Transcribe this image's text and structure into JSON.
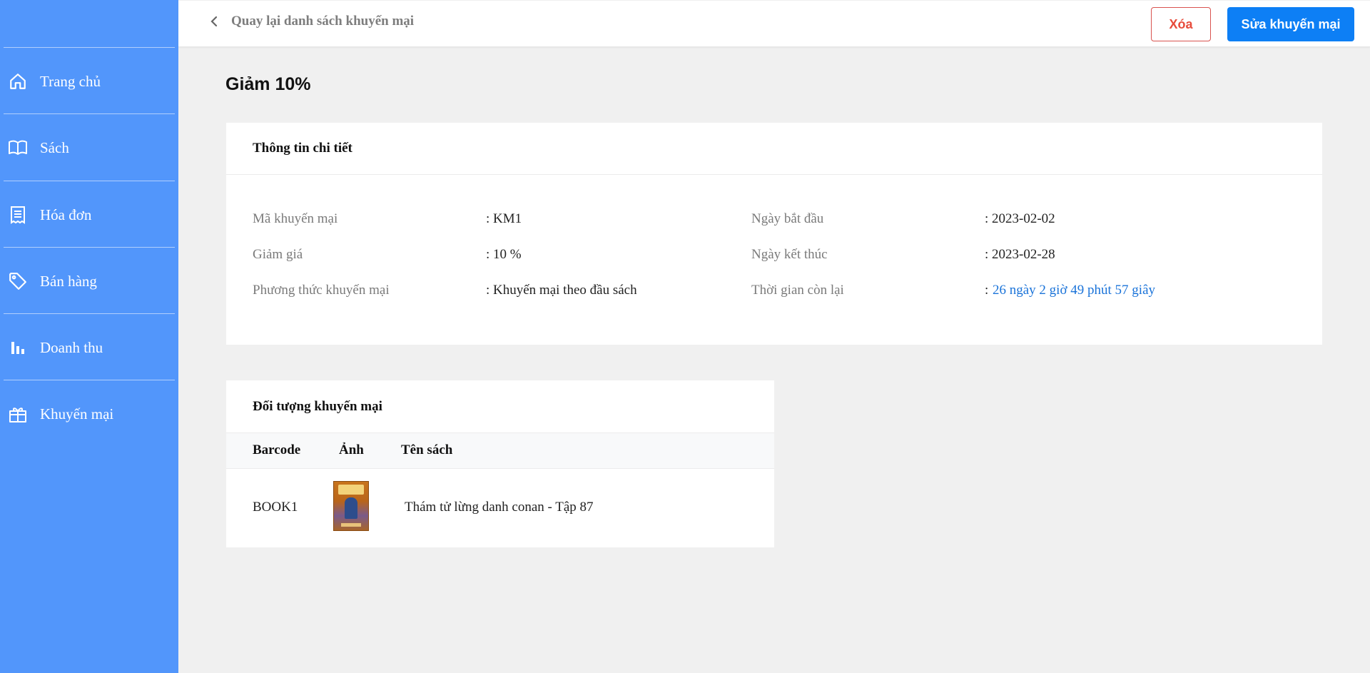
{
  "sidebar": {
    "items": [
      {
        "label": "Trang chủ",
        "icon": "home-icon"
      },
      {
        "label": "Sách",
        "icon": "book-icon"
      },
      {
        "label": "Hóa đơn",
        "icon": "receipt-icon"
      },
      {
        "label": "Bán hàng",
        "icon": "tag-icon"
      },
      {
        "label": "Doanh thu",
        "icon": "bar-chart-icon"
      },
      {
        "label": "Khuyến mại",
        "icon": "gift-icon"
      }
    ]
  },
  "header": {
    "back_label": "Quay lại danh sách khuyến mại",
    "delete_label": "Xóa",
    "edit_label": "Sửa khuyến mại"
  },
  "page_title": "Giảm 10%",
  "details": {
    "title": "Thông tin chi tiết",
    "code_label": "Mã khuyến mại",
    "code_value": ": KM1",
    "discount_label": "Giảm giá",
    "discount_value": ": 10 %",
    "method_label": "Phương thức khuyến mại",
    "method_value": ": Khuyến mại theo đầu sách",
    "start_label": "Ngày bắt đầu",
    "start_value": ": 2023-02-02",
    "end_label": "Ngày kết thúc",
    "end_value": ": 2023-02-28",
    "remaining_label": "Thời gian còn lại",
    "remaining_colon": ":",
    "remaining_value": "26 ngày 2 giờ 49 phút 57 giây"
  },
  "targets": {
    "title": "Đối tượng khuyến mại",
    "columns": [
      "Barcode",
      "Ảnh",
      "Tên sách"
    ],
    "rows": [
      {
        "barcode": "BOOK1",
        "image": "book-cover-conan",
        "name": "Thám tử lừng danh conan - Tập 87"
      }
    ]
  },
  "colors": {
    "sidebar": "#5296fb",
    "primary": "#0d7ff5",
    "danger": "#e74c3c",
    "link_blue": "#1a73d9"
  }
}
